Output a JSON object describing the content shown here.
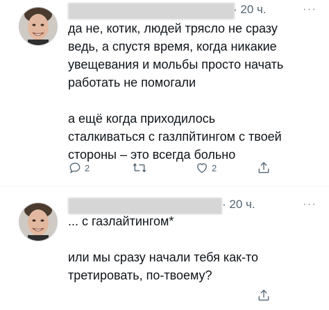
{
  "tweets": [
    {
      "time": "· 20 ч.",
      "more": "···",
      "lines_1": [
        "да не, котик, людей трясло не сразу",
        "ведь, а спустя время, когда никакие",
        "увещевания и мольбы просто начать",
        "работать не помогали"
      ],
      "lines_2": [
        "а ещё когда приходилось",
        "сталкиваться с газлпйтингом с твоей",
        "стороны – это всегда больно"
      ],
      "actions": {
        "reply_icon": "reply-icon",
        "reply_count": "2",
        "retweet_icon": "retweet-icon",
        "like_icon": "heart-icon",
        "like_count": "2",
        "share_icon": "share-icon"
      }
    },
    {
      "time": "· 20 ч.",
      "more": "···",
      "lines_1": [
        "... с газлайтингом*"
      ],
      "lines_2": [
        "или мы сразу начали тебя как-то",
        "третировать, по-твоему?"
      ],
      "actions": {
        "share_icon": "share-icon"
      }
    }
  ],
  "colors": {
    "text": "#0f1419",
    "secondary": "#536471",
    "redaction": "#d6d6d6"
  }
}
